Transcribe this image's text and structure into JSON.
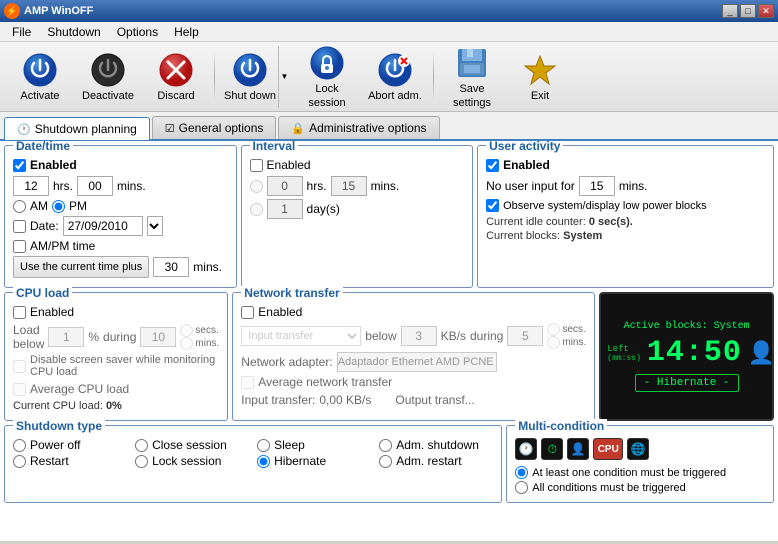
{
  "window": {
    "title": "AMP WinOFF",
    "buttons": [
      "_",
      "□",
      "✕"
    ]
  },
  "menu": {
    "items": [
      "File",
      "Shutdown",
      "Options",
      "Help"
    ]
  },
  "toolbar": {
    "buttons": [
      {
        "id": "activate",
        "label": "Activate",
        "icon": "⏻"
      },
      {
        "id": "deactivate",
        "label": "Deactivate",
        "icon": "⏻"
      },
      {
        "id": "discard",
        "label": "Discard",
        "icon": "✕"
      },
      {
        "id": "shutdown",
        "label": "Shut down",
        "icon": "⏻"
      },
      {
        "id": "lock-session",
        "label": "Lock session",
        "icon": "🔒"
      },
      {
        "id": "abort",
        "label": "Abort adm.",
        "icon": "⏻"
      },
      {
        "id": "save-settings",
        "label": "Save settings",
        "icon": "💾"
      },
      {
        "id": "exit",
        "label": "Exit",
        "icon": "★"
      }
    ]
  },
  "tabs": [
    {
      "id": "shutdown-planning",
      "label": "Shutdown planning",
      "icon": "🕐",
      "active": true
    },
    {
      "id": "general-options",
      "label": "General options",
      "icon": "☑"
    },
    {
      "id": "administrative-options",
      "label": "Administrative options",
      "icon": "🔒"
    }
  ],
  "panels": {
    "datetime": {
      "title": "Date/time",
      "enabled": true,
      "hours": "12",
      "minutes": "00",
      "ampm_am": true,
      "ampm_pm": false,
      "date_enabled": false,
      "date_value": "27/09/2010",
      "ampm_time": false,
      "use_current_label": "Use the current time plus",
      "plus_minutes": "30",
      "mins_label": "mins."
    },
    "interval": {
      "title": "Interval",
      "enabled": false,
      "hrs": "0",
      "mins": "15",
      "days": "1"
    },
    "user_activity": {
      "title": "User activity",
      "enabled": true,
      "no_input_label": "No user input for",
      "no_input_value": "15",
      "mins_label": "mins.",
      "observe_system": true,
      "observe_label": "Observe system/display low power blocks",
      "idle_label": "Current idle counter:",
      "idle_value": "0 sec(s).",
      "blocks_label": "Current blocks:",
      "blocks_value": "System"
    },
    "cpu_load": {
      "title": "CPU load",
      "enabled": false,
      "load_below": "1",
      "pct_label": "%",
      "during": "10",
      "secs_checked": true,
      "mins_checked": false,
      "disable_screensaver": false,
      "disable_screensaver_label": "Disable screen saver while monitoring CPU load",
      "average_cpu": false,
      "average_cpu_label": "Average CPU load",
      "current_load_label": "Current CPU load:",
      "current_load_value": "0%"
    },
    "network": {
      "title": "Network transfer",
      "enabled": false,
      "transfer_type": "Input transfer",
      "below": "3",
      "kb_label": "KB/s",
      "during": "5",
      "adapter_label": "Network adapter:",
      "adapter_value": "Adaptador Ethernet AMD PCNE",
      "average_network": false,
      "average_network_label": "Average network transfer",
      "input_transfer_label": "Input transfer:",
      "input_transfer_value": "0,00 KB/s",
      "output_transfer_label": "Output transf..."
    },
    "clock_display": {
      "active_blocks": "Active blocks: System",
      "left_label": "Left",
      "mmss_label": "(mm:ss)",
      "time": "14:50",
      "hibernate_label": "- Hibernate -"
    },
    "shutdown_type": {
      "title": "Shutdown type",
      "options": [
        {
          "id": "power-off",
          "label": "Power off",
          "checked": true
        },
        {
          "id": "close-session",
          "label": "Close session",
          "checked": false
        },
        {
          "id": "sleep",
          "label": "Sleep",
          "checked": false
        },
        {
          "id": "adm-shutdown",
          "label": "Adm. shutdown",
          "checked": false
        },
        {
          "id": "restart",
          "label": "Restart",
          "checked": false
        },
        {
          "id": "lock-session",
          "label": "Lock session",
          "checked": false
        },
        {
          "id": "hibernate",
          "label": "Hibernate",
          "checked": false
        },
        {
          "id": "adm-restart",
          "label": "Adm. restart",
          "checked": false
        }
      ]
    },
    "multi_condition": {
      "title": "Multi-condition",
      "option1": "At least one condition must be triggered",
      "option2": "All conditions must be triggered"
    }
  }
}
